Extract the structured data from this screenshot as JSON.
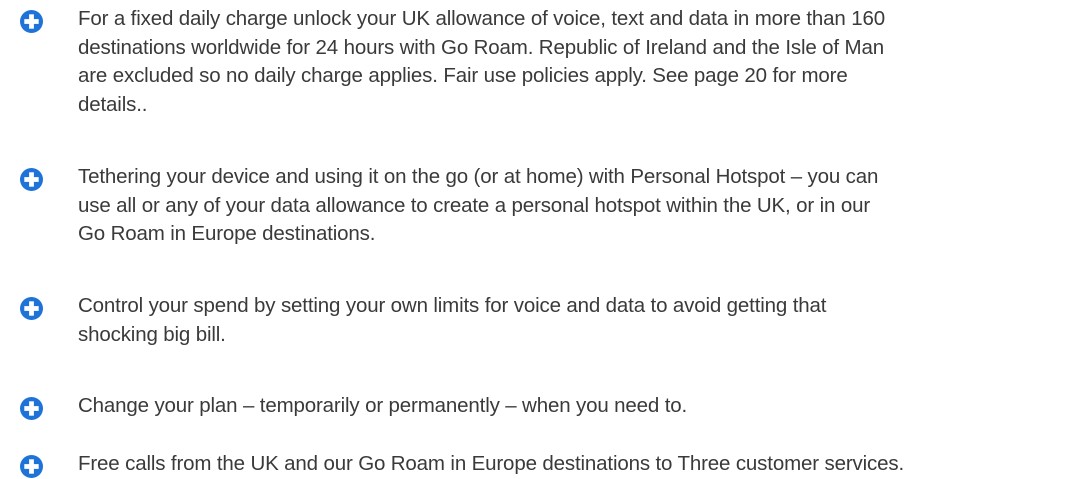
{
  "benefits": {
    "icon": "plus-circle-icon",
    "icon_color": "#1e73d8",
    "text_color": "#3a3a3a",
    "items": [
      {
        "text": "For a fixed daily charge unlock your UK allowance of voice, text and data in more than 160\ndestinations worldwide for 24 hours with Go Roam. Republic of Ireland and the Isle of Man\nare excluded so no daily charge applies. Fair use policies apply. See page 20 for more\ndetails.."
      },
      {
        "text": "Tethering your device and using it on the go (or at home) with Personal Hotspot – you can\nuse all or any of your data allowance to create a personal hotspot within the UK, or in our\nGo Roam in Europe destinations."
      },
      {
        "text": "Control your spend by setting your own limits for voice and data to avoid getting that\nshocking big bill."
      },
      {
        "text": "Change your plan – temporarily or permanently – when you need to."
      },
      {
        "text": "Free calls from the UK and our Go Roam in Europe destinations to Three customer services."
      }
    ]
  }
}
